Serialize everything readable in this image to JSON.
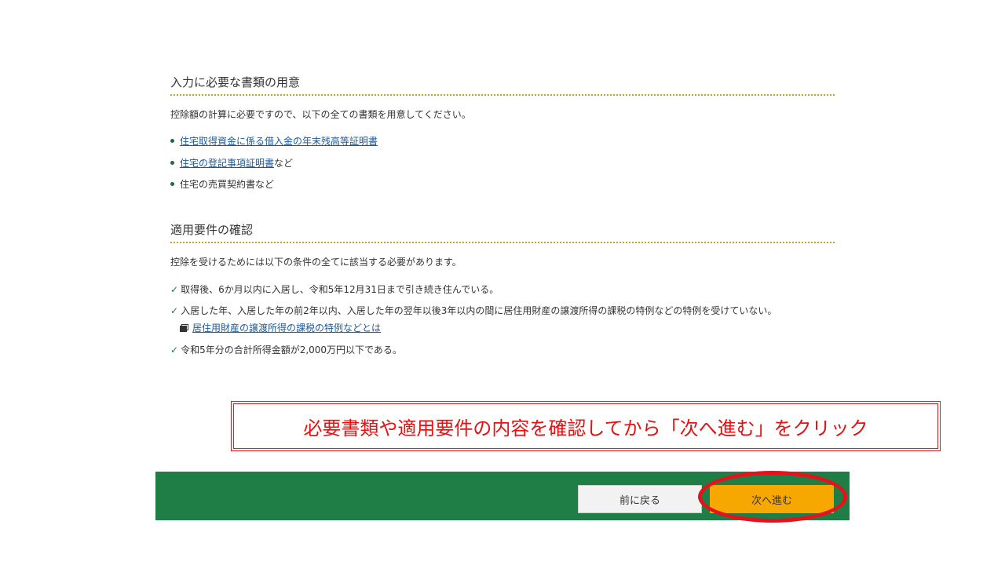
{
  "documents": {
    "title": "入力に必要な書類の用意",
    "description": "控除額の計算に必要ですので、以下の全ての書類を用意してください。",
    "items": [
      {
        "link": "住宅取得資金に係る借入金の年末残高等証明書",
        "suffix": ""
      },
      {
        "link": "住宅の登記事項証明書",
        "suffix": "など"
      },
      {
        "link": "",
        "suffix": "住宅の売買契約書など"
      }
    ]
  },
  "requirements": {
    "title": "適用要件の確認",
    "description": "控除を受けるためには以下の条件の全てに該当する必要があります。",
    "items": [
      "取得後、6か月以内に入居し、令和5年12月31日まで引き続き住んでいる。",
      "入居した年、入居した年の前2年以内、入居した年の翌年以後3年以内の間に居住用財産の譲渡所得の課税の特例などの特例を受けていない。",
      "令和5年分の合計所得金額が2,000万円以下である。"
    ],
    "sub_link": "居住用財産の譲渡所得の課税の特例などとは",
    "check_mark": "✓"
  },
  "callout": {
    "text": "必要書類や適用要件の内容を確認してから「次へ進む」をクリック"
  },
  "footer": {
    "back_label": "前に戻る",
    "next_label": "次へ進む"
  },
  "colors": {
    "footer_bg": "#1e7e46",
    "next_button": "#f7a800",
    "accent_dotted": "#c9a22c",
    "callout_red": "#e81010"
  }
}
